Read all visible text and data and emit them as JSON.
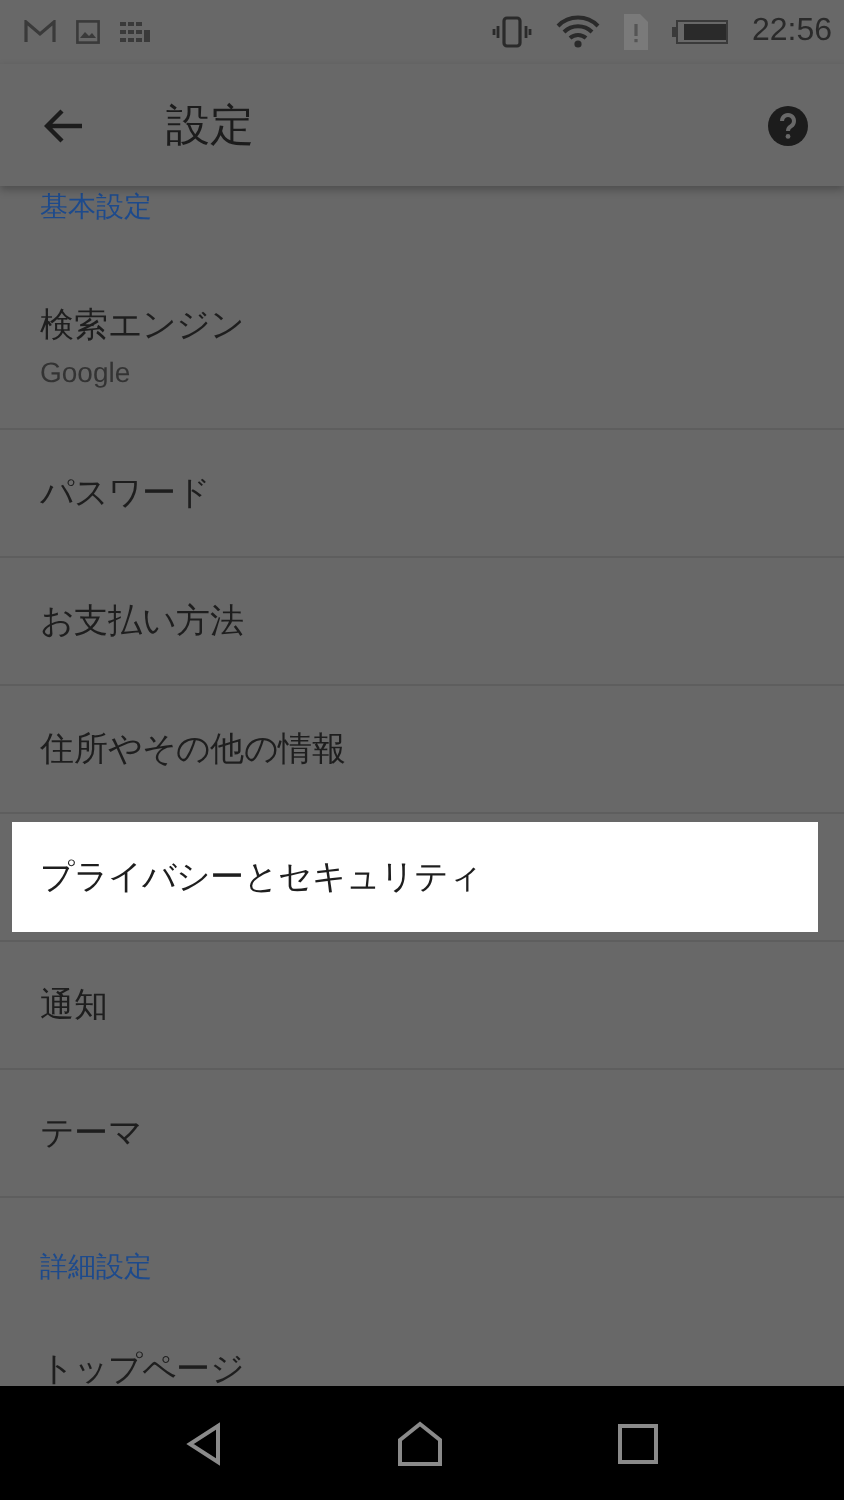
{
  "status_bar": {
    "time": "22:56"
  },
  "toolbar": {
    "title": "設定"
  },
  "list": [
    {
      "kind": "header",
      "label": "基本設定"
    },
    {
      "kind": "item",
      "label": "検索エンジン",
      "summary": "Google",
      "highlighted": false
    },
    {
      "kind": "item",
      "label": "パスワード",
      "highlighted": false
    },
    {
      "kind": "item",
      "label": "お支払い方法",
      "highlighted": false
    },
    {
      "kind": "item",
      "label": "住所やその他の情報",
      "highlighted": false
    },
    {
      "kind": "item",
      "label": "プライバシーとセキュリティ",
      "highlighted": true
    },
    {
      "kind": "item",
      "label": "通知",
      "highlighted": false
    },
    {
      "kind": "item",
      "label": "テーマ",
      "highlighted": false
    },
    {
      "kind": "header",
      "label": "詳細設定"
    },
    {
      "kind": "item",
      "label": "トップページ",
      "highlighted": false
    }
  ]
}
